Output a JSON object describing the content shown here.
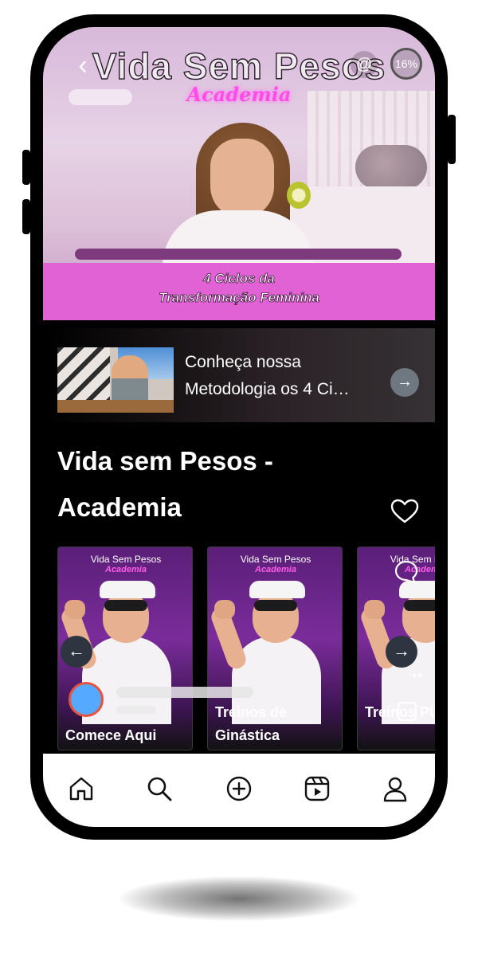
{
  "hero": {
    "brand_title": "Vida Sem Pesos",
    "brand_subtitle": "Academia",
    "banner_line1": "4 Ciclos da",
    "banner_line2": "Transformação Feminina",
    "progress_text": "16%",
    "at_icon": "at-icon"
  },
  "video": {
    "title": "Conheça nossa Metodologia os 4 Ci…"
  },
  "section": {
    "title": "Vida sem Pesos - Academia"
  },
  "carousel": {
    "items": [
      {
        "brand": "Vida Sem Pesos",
        "brand_sub": "Academia",
        "label": "Comece Aqui"
      },
      {
        "brand": "Vida Sem Pesos",
        "brand_sub": "Academia",
        "label": "Treinos de Ginástica"
      },
      {
        "brand": "Vida Sem Pesos",
        "brand_sub": "Academia",
        "label": "Treinos PUMP"
      }
    ]
  },
  "bottom_nav": {
    "items": [
      "home-icon",
      "search-icon",
      "create-icon",
      "reels-icon",
      "profile-icon"
    ]
  },
  "colors": {
    "accent_pink": "#e062d4",
    "neon_pink": "#ff4ee8",
    "card_purple": "#7a2c9a",
    "avatar_blue": "#55aaff",
    "avatar_ring": "#e9533d"
  }
}
